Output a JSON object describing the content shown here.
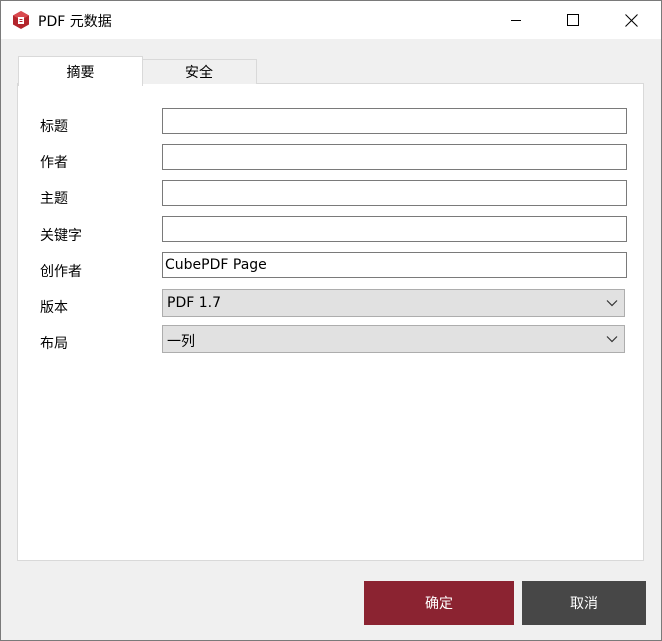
{
  "window": {
    "title": "PDF 元数据",
    "app_icon": "cubepdf-logo-icon",
    "controls": [
      "minimize-icon",
      "maximize-icon",
      "close-icon"
    ]
  },
  "tabs": [
    {
      "label": "摘要",
      "active": true
    },
    {
      "label": "安全",
      "active": false
    }
  ],
  "form": {
    "title_label": "标题",
    "title_value": "",
    "author_label": "作者",
    "author_value": "",
    "subject_label": "主题",
    "subject_value": "",
    "keywords_label": "关键字",
    "keywords_value": "",
    "creator_label": "创作者",
    "creator_value": "CubePDF Page",
    "version_label": "版本",
    "version_value": "PDF 1.7",
    "layout_label": "布局",
    "layout_value": "一列"
  },
  "buttons": {
    "ok_label": "确定",
    "cancel_label": "取消"
  },
  "colors": {
    "accent": "#8b2331",
    "secondary_button": "#474747",
    "window_bg": "#f0f0f0",
    "panel_bg": "#ffffff"
  }
}
